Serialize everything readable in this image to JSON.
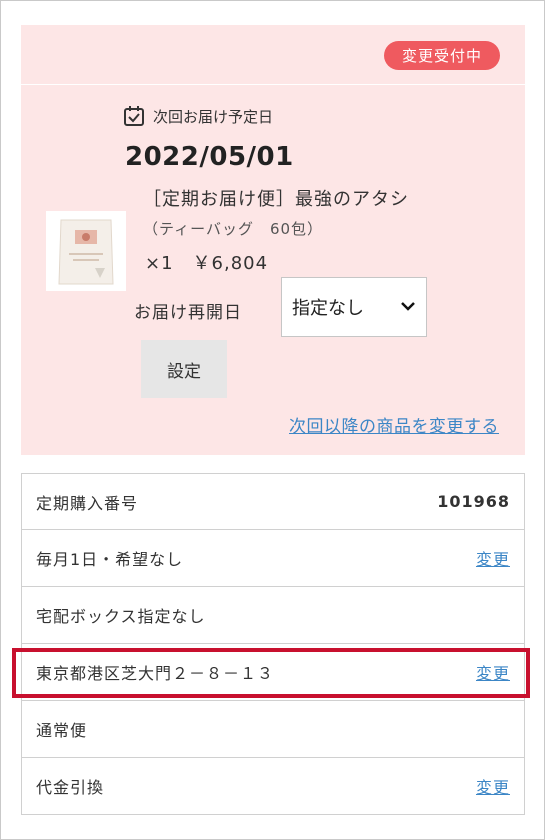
{
  "status_badge": "変更受付中",
  "next_delivery": {
    "label": "次回お届け予定日",
    "date": "2022/05/01"
  },
  "product": {
    "name_line1": "［定期お届け便］最強のアタシ",
    "name_line2": "（ティーバッグ　60包）",
    "qty_price": "×1　￥6,804"
  },
  "resume": {
    "label": "お届け再開日",
    "selected": "指定なし"
  },
  "set_button": "設定",
  "change_products_link": "次回以降の商品を変更する",
  "details": {
    "order_label": "定期購入番号",
    "order_number": "101968",
    "schedule": "毎月1日・希望なし",
    "box": "宅配ボックス指定なし",
    "address": "東京都港区芝大門２－８－１３",
    "shipping": "通常便",
    "payment": "代金引換",
    "change_label": "変更"
  },
  "colors": {
    "badge": "#ef5a5f",
    "panel": "#fde6e6",
    "link": "#3c86c6",
    "highlight": "#c8102e"
  }
}
